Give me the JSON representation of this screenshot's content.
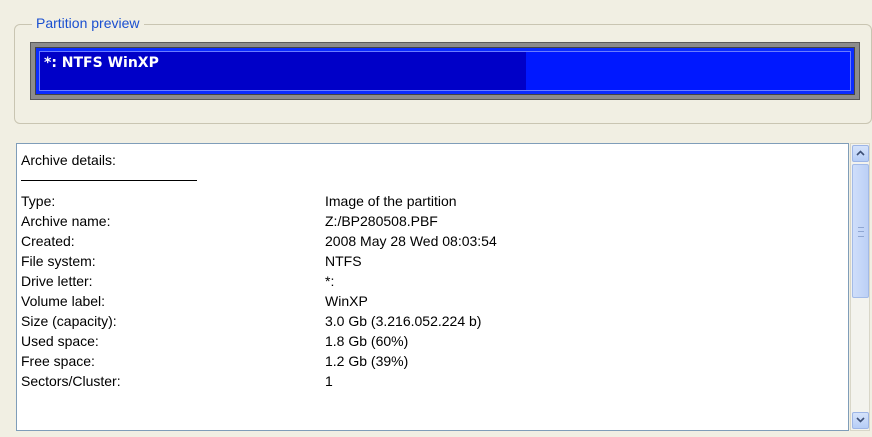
{
  "partition_preview": {
    "label": "Partition preview",
    "bar_text": "*: NTFS WinXP",
    "used_fraction": 0.6
  },
  "details": {
    "title": "Archive details:",
    "rows": [
      {
        "key": "Type:",
        "value": "Image of the partition"
      },
      {
        "key": "Archive name:",
        "value": "Z:/BP280508.PBF"
      },
      {
        "key": "Created:",
        "value": "2008 May 28 Wed 08:03:54"
      },
      {
        "key": "File system:",
        "value": "NTFS"
      },
      {
        "key": "Drive letter:",
        "value": "*:"
      },
      {
        "key": "Volume label:",
        "value": "WinXP"
      },
      {
        "key": "Size (capacity):",
        "value": "3.0 Gb (3.216.052.224 b)"
      },
      {
        "key": "Used space:",
        "value": "1.8 Gb (60%)"
      },
      {
        "key": "Free space:",
        "value": "1.2 Gb (39%)"
      },
      {
        "key": "Sectors/Cluster:",
        "value": "1"
      }
    ]
  },
  "scrollbar": {
    "up_icon": "chevron-up-icon",
    "down_icon": "chevron-down-icon"
  }
}
